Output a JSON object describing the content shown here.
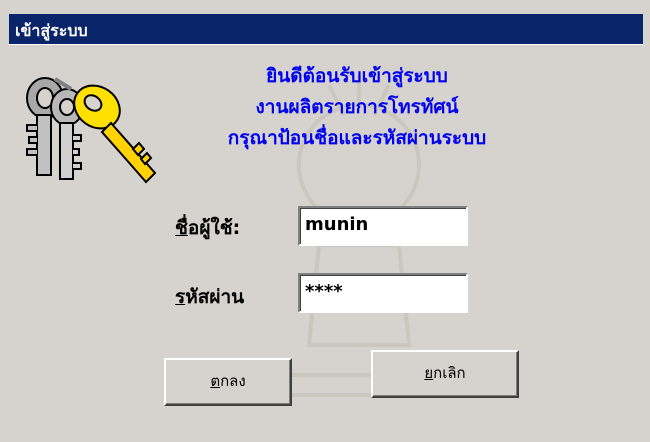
{
  "window": {
    "title": "เข้าสู่ระบบ"
  },
  "welcome": {
    "line1": "ยินดีต้อนรับเข้าสู่ระบบ",
    "line2": "งานผลิตรายการโทรทัศน์",
    "line3": "กรุณาป้อนชื่อและรหัสผ่านระบบ"
  },
  "username": {
    "mnemonic": "ชื่",
    "label_rest": "อผู้ใช้:",
    "value": "munin"
  },
  "password": {
    "mnemonic": "ร",
    "label_rest": "หัสผ่าน",
    "value": "****"
  },
  "buttons": {
    "ok_mnemonic": "ต",
    "ok_rest": "กลง",
    "cancel_mnemonic": "ย",
    "cancel_rest": "กเลิก"
  },
  "colors": {
    "titlebar": "#0a246a",
    "welcome_text": "#0000f0",
    "dialog_bg": "#d6d3ce"
  },
  "icons": {
    "keys": "keys-icon"
  }
}
